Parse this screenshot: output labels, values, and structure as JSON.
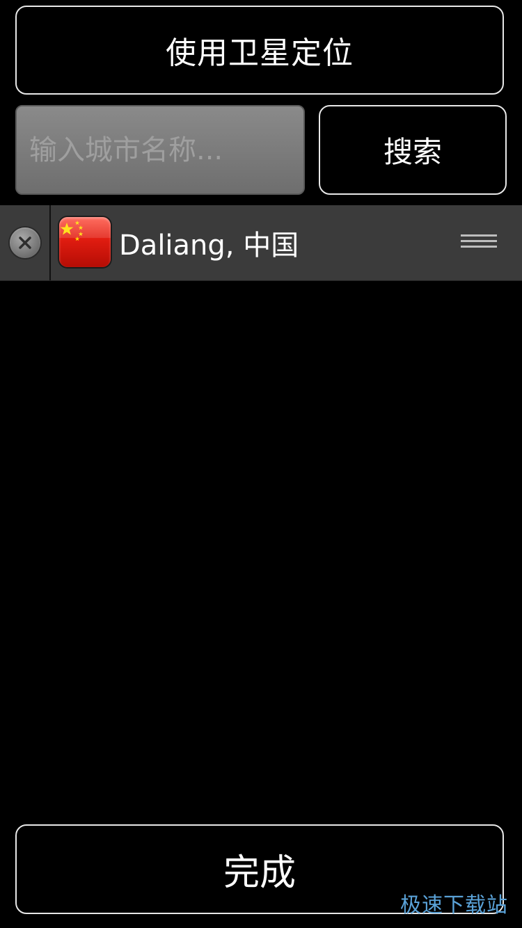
{
  "gps_button": {
    "label": "使用卫星定位"
  },
  "search": {
    "placeholder": "输入城市名称...",
    "value": "",
    "button_label": "搜索"
  },
  "city_list": {
    "items": [
      {
        "name": "Daliang, 中国",
        "flag_icon": "china-flag-icon",
        "delete_icon": "close-circle-icon",
        "handle_icon": "drag-handle-icon"
      }
    ]
  },
  "done_button": {
    "label": "完成"
  },
  "watermark": {
    "text": "极速下载站"
  },
  "colors": {
    "background": "#000000",
    "row_background": "#3b3b3b",
    "flag_red": "#e01c10",
    "flag_star": "#ffde00",
    "watermark": "#5aa2d8"
  }
}
